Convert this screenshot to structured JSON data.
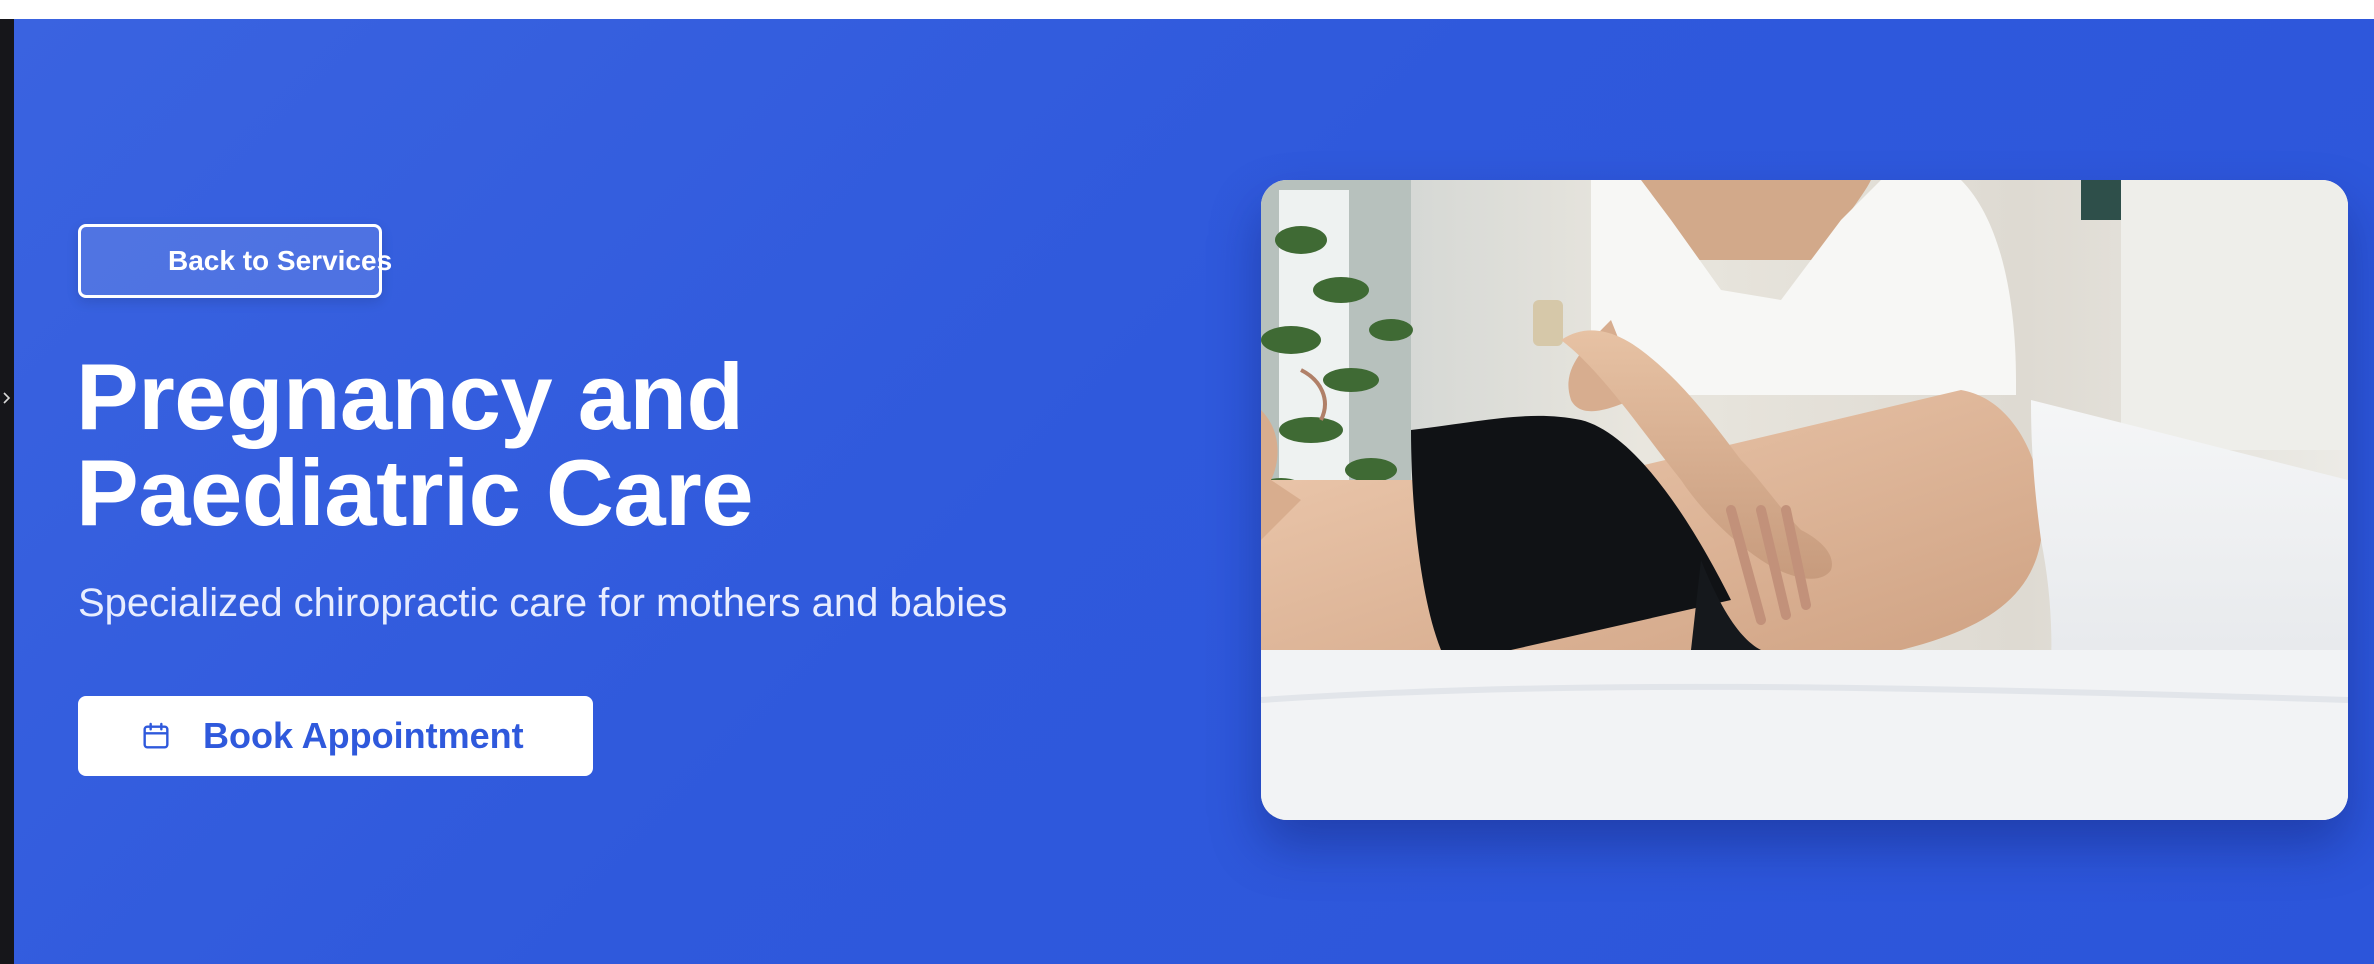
{
  "hero": {
    "back_label": "Back to Services",
    "title_line1": "Pregnancy and",
    "title_line2": "Paediatric Care",
    "subtitle": "Specialized chiropractic care for mothers and babies",
    "book_label": "Book Appointment"
  },
  "icons": {
    "back": "arrow-left-icon",
    "book": "calendar-icon",
    "side": "chevron-right-icon"
  },
  "colors": {
    "hero_background": "#2f59dc",
    "button_text": "#2f59dc",
    "text_primary": "#ffffff"
  }
}
